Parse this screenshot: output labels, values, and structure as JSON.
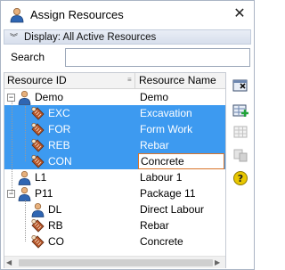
{
  "window": {
    "title": "Assign Resources",
    "close_glyph": "✕"
  },
  "display": {
    "label": "Display: All Active Resources"
  },
  "search": {
    "label": "Search",
    "value": "",
    "placeholder": ""
  },
  "grid": {
    "columns": [
      "Resource ID",
      "Resource Name"
    ],
    "rows": [
      {
        "id": "Demo",
        "name": "Demo",
        "kind": "project",
        "expand": "−",
        "selected": false
      },
      {
        "id": "EXC",
        "name": "Excavation",
        "kind": "resource",
        "selected": true
      },
      {
        "id": "FOR",
        "name": "Form Work",
        "kind": "resource",
        "selected": true
      },
      {
        "id": "REB",
        "name": "Rebar",
        "kind": "resource",
        "selected": true
      },
      {
        "id": "CON",
        "name": "Concrete",
        "kind": "resource",
        "selected": true,
        "focused": true
      },
      {
        "id": "L1",
        "name": "Labour 1",
        "kind": "labour",
        "selected": false
      },
      {
        "id": "P11",
        "name": "Package 11",
        "kind": "project",
        "expand": "−",
        "selected": false
      },
      {
        "id": "DL",
        "name": "Direct Labour",
        "kind": "labour",
        "selected": false
      },
      {
        "id": "RB",
        "name": "Rebar",
        "kind": "resource",
        "selected": false
      },
      {
        "id": "CO",
        "name": "Concrete",
        "kind": "resource",
        "selected": false
      }
    ]
  },
  "toolbar": {
    "icons": [
      "remove-resource-icon",
      "add-resource-icon",
      "grid-options-icon",
      "resource-copy-icon",
      "help-icon"
    ],
    "help_glyph": "?"
  },
  "colors": {
    "selection": "#3d9af0",
    "focus_border": "#d9742a",
    "help": "#e8c700"
  }
}
